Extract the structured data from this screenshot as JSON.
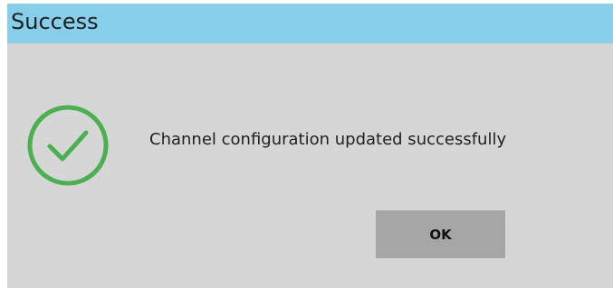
{
  "dialog": {
    "title": "Success",
    "message": "Channel configuration updated successfully",
    "icon": "check-circle-icon",
    "ok_label": "OK"
  },
  "colors": {
    "titlebar": "#87ceeb",
    "body": "#d6d6d6",
    "button": "#a6a6a6",
    "success": "#4caf50"
  }
}
